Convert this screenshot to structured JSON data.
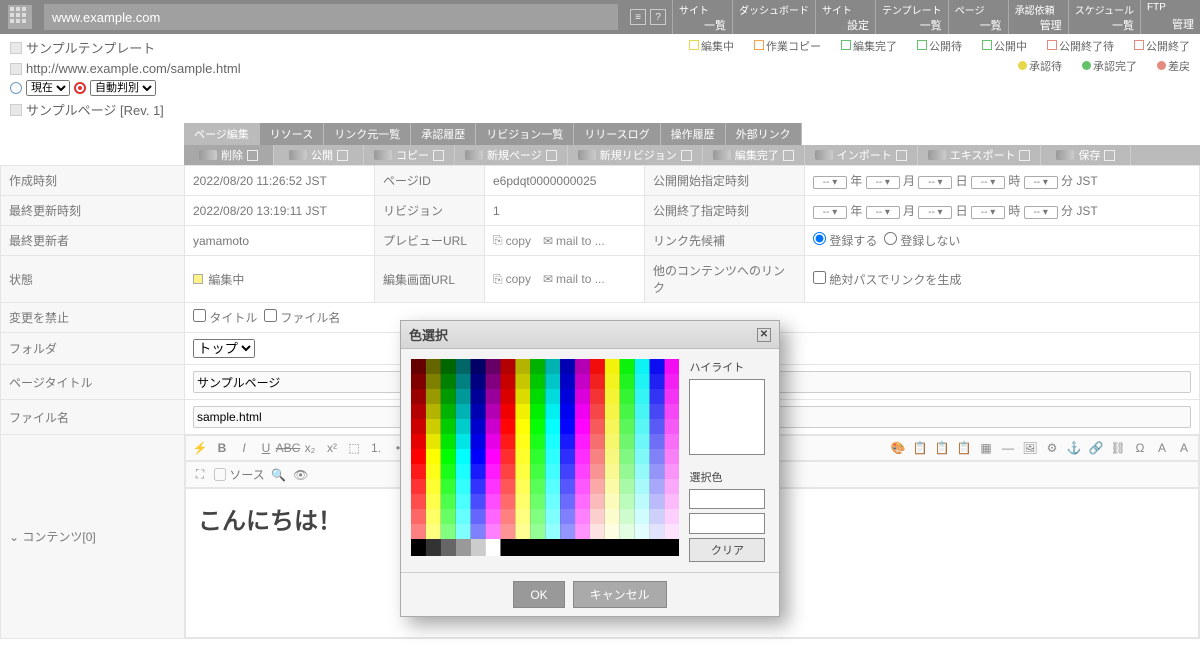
{
  "top": {
    "url": "www.example.com",
    "tabs": [
      {
        "t1": "サイト",
        "t2": "一覧"
      },
      {
        "t1": "ダッシュボード",
        "t2": ""
      },
      {
        "t1": "サイト",
        "t2": "設定"
      },
      {
        "t1": "テンプレート",
        "t2": "一覧"
      },
      {
        "t1": "ページ",
        "t2": "一覧"
      },
      {
        "t1": "承認依頼",
        "t2": "管理"
      },
      {
        "t1": "スケジュール",
        "t2": "一覧"
      },
      {
        "t1": "FTP",
        "t2": "管理"
      }
    ]
  },
  "ctx": {
    "template": "サンプルテンプレート",
    "page_url": "http://www.example.com/sample.html",
    "page_name": "サンプルページ [Rev. 1]",
    "now_opt": "現在",
    "auto_opt": "自動判別"
  },
  "statuses": [
    {
      "label": "編集中",
      "color": "#e6d84a"
    },
    {
      "label": "作業コピー",
      "color": "#f5a34a"
    },
    {
      "label": "編集完了",
      "color": "#63c36b"
    },
    {
      "label": "公開待",
      "color": "#63c36b"
    },
    {
      "label": "公開中",
      "color": "#63c36b"
    },
    {
      "label": "公開終了待",
      "color": "#e48a80"
    },
    {
      "label": "公開終了",
      "color": "#e48a80"
    }
  ],
  "approv": [
    {
      "label": "承認待",
      "color": "#e6d84a"
    },
    {
      "label": "承認完了",
      "color": "#63c36b"
    },
    {
      "label": "差戻",
      "color": "#e48a80"
    }
  ],
  "tabs": [
    "ページ編集",
    "リソース",
    "リンク元一覧",
    "承認履歴",
    "リビジョン一覧",
    "リリースログ",
    "操作履歴",
    "外部リンク"
  ],
  "actions": [
    "削除",
    "公開",
    "コピー",
    "新規ページ",
    "新規リビジョン",
    "編集完了",
    "インポート",
    "エキスポート",
    "保存"
  ],
  "props": {
    "created_label": "作成時刻",
    "created": "2022/08/20 11:26:52 JST",
    "updated_label": "最終更新時刻",
    "updated": "2022/08/20 13:19:11 JST",
    "updater_label": "最終更新者",
    "updater": "yamamoto",
    "state_label": "状態",
    "state": "編集中",
    "lock_label": "変更を禁止",
    "lock_title": "タイトル",
    "lock_file": "ファイル名",
    "folder_label": "フォルダ",
    "folder_opt": "トップ",
    "title_label": "ページタイトル",
    "title": "サンプルページ",
    "file_label": "ファイル名",
    "file": "sample.html",
    "contents_label": "コンテンツ[0]",
    "pageid_label": "ページID",
    "pageid": "e6pdqt0000000025",
    "rev_label": "リビジョン",
    "rev": "1",
    "preview_label": "プレビューURL",
    "edit_label": "編集画面URL",
    "copy": "copy",
    "mailto": "mail to ...",
    "pub_start_label": "公開開始指定時刻",
    "pub_end_label": "公開終了指定時刻",
    "link_cand_label": "リンク先候補",
    "reg_yes": "登録する",
    "reg_no": "登録しない",
    "other_link_label": "他のコンテンツへのリンク",
    "abs_path": "絶対パスでリンクを生成",
    "date_units": {
      "y": "年",
      "m": "月",
      "d": "日",
      "h": "時",
      "min": "分",
      "tz": "JST",
      "none": "--"
    }
  },
  "editor": {
    "source": "ソース",
    "body": "こんにちは！"
  },
  "modal": {
    "title": "色選択",
    "highlight": "ハイライト",
    "selected": "選択色",
    "clear": "クリア",
    "ok": "OK",
    "cancel": "キャンセル"
  }
}
